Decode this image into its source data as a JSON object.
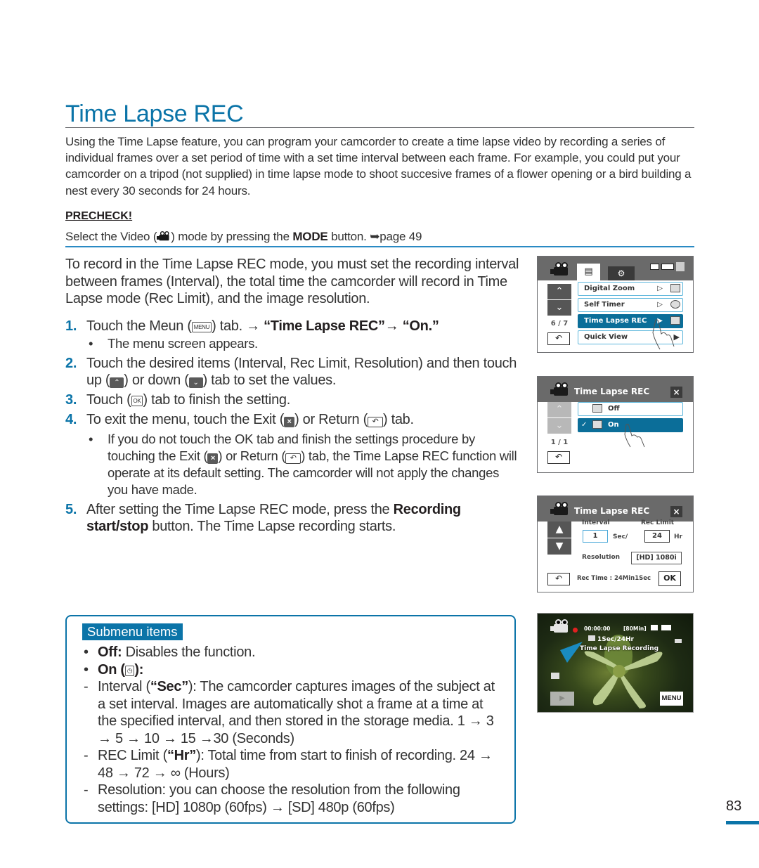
{
  "page": {
    "title": "Time Lapse REC",
    "intro": "Using the Time Lapse feature, you can program your camcorder to create a time lapse video by recording a series of individual frames over a set period of time with a set time interval between each frame. For example, you could put your camcorder on a tripod (not supplied) in time lapse mode to shoot succesive frames of a flower opening or a bird building a nest every 30 seconds for 24 hours.",
    "page_number": "83"
  },
  "precheck": {
    "label": "PRECHECK!",
    "text_before": "Select the Video (",
    "text_mid": ") mode by pressing the ",
    "mode_word": "MODE",
    "text_after": " button. ",
    "page_ref": "➥page 49"
  },
  "lead": "To record in the Time Lapse REC mode, you must set the recording interval between frames (Interval), the total time the camcorder will record in Time Lapse mode (Rec Limit), and the image resolution.",
  "steps": [
    {
      "num": "1.",
      "a": "Touch the Meun (",
      "key": "MENU",
      "b": ") tab. → ",
      "bold": "“Time Lapse REC”→ “On.”",
      "sub": "The menu screen appears."
    },
    {
      "num": "2.",
      "a": "Touch the desired items (Interval, Rec Limit, Resolution) and then touch up (",
      "b": ") or down (",
      "c": ") tab to set the values."
    },
    {
      "num": "3.",
      "a": "Touch (",
      "key": "OK",
      "b": ") tab to finish the setting."
    },
    {
      "num": "4.",
      "a": "To exit the menu, touch the Exit (",
      "b": ") or Return (",
      "c": ") tab.",
      "sub_a": "If you do not touch the OK tab and finish the settings procedure by touching the Exit (",
      "sub_b": ") or Return (",
      "sub_c": ") tab, the Time Lapse REC function will operate at its default setting. The camcorder will not apply the changes you have made."
    },
    {
      "num": "5.",
      "a": "After setting the Time Lapse REC mode, press the ",
      "bold": "Recording start/stop",
      "b": " button. The Time Lapse recording starts."
    }
  ],
  "submenu": {
    "tag": "Submenu items",
    "off_label": "Off:",
    "off_text": " Disables the function.",
    "on_label": "On (",
    "on_label_end": "):",
    "interval_a": "Interval (",
    "interval_bold": "“Sec”",
    "interval_b": "): The camcorder captures images of the subject at a set interval. Images are automatically shot a frame at a time at the specified interval, and then stored in the storage media. 1 → 3 → 5 → 10 → 15 →30 (Seconds)",
    "limit_a": "REC Limit (",
    "limit_bold": "“Hr”",
    "limit_b": "): Total time from start to finish of recording. 24 → 48 → 72 → ∞ (Hours)",
    "resolution": "Resolution: you can choose the resolution from the following settings: [HD] 1080p (60fps) → [SD] 480p (60fps)"
  },
  "screen1": {
    "items": [
      "Digital Zoom",
      "Self Timer",
      "Time Lapse REC",
      "Quick View"
    ],
    "page": "6 / 7"
  },
  "screen2": {
    "title": "Time Lapse REC",
    "options": [
      "Off",
      "On"
    ],
    "selected": "On",
    "page": "1 / 1"
  },
  "screen3": {
    "title": "Time Lapse REC",
    "interval_label": "Interval",
    "interval_value": "1",
    "interval_unit": "Sec/",
    "limit_label": "Rec Limit",
    "limit_value": "24",
    "limit_unit": "Hr",
    "resolution_label": "Resolution",
    "resolution_value": "[HD] 1080i",
    "rec_time": "Rec Time : 24Min1Sec",
    "ok": "OK"
  },
  "screen4": {
    "timecode": "00:00:00",
    "remaining": "[80Min]",
    "setting": "1Sec/24Hr",
    "status": "Time Lapse Recording",
    "menu": "MENU"
  },
  "colors": {
    "accent": "#0b74a8",
    "text": "#333333"
  }
}
